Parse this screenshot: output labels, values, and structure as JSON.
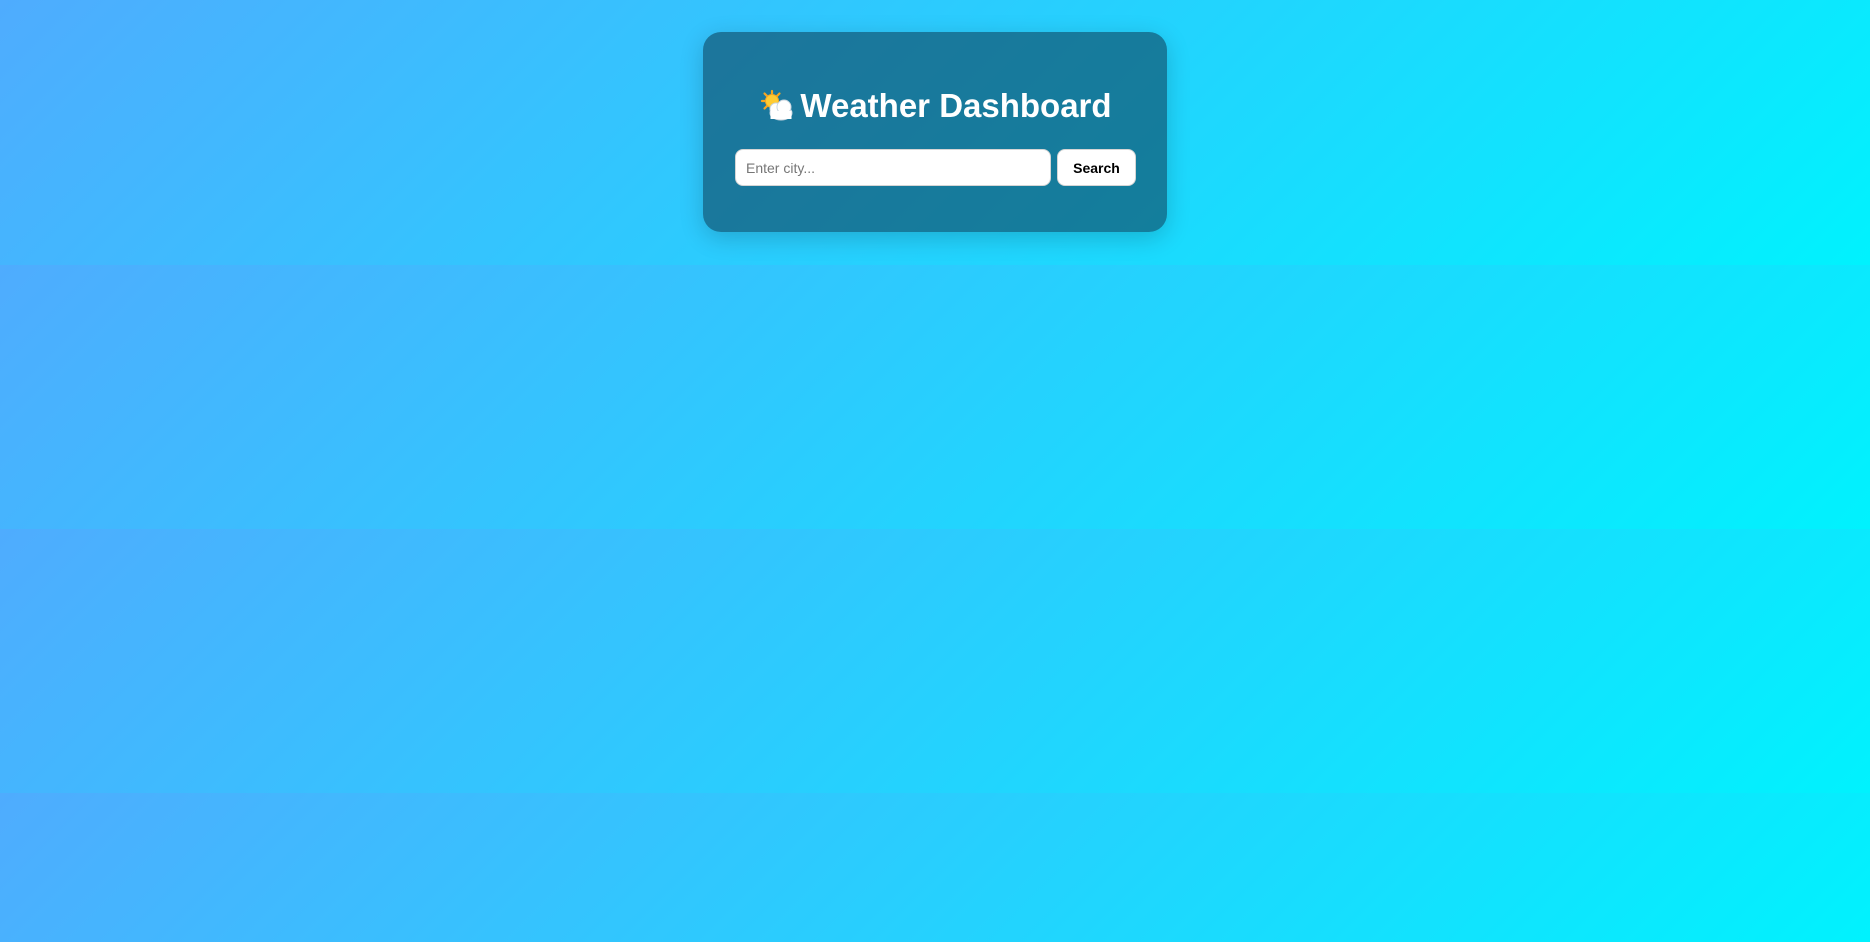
{
  "app": {
    "title": "Weather Dashboard",
    "title_icon": "sun-behind-cloud-icon"
  },
  "search": {
    "placeholder": "Enter city...",
    "value": "",
    "button_label": "Search"
  },
  "colors": {
    "background_gradient_start": "#4facfe",
    "background_gradient_end": "#00f2fe",
    "card_background": "#1a7a96",
    "title_text": "#ffffff",
    "button_text": "#000000"
  }
}
